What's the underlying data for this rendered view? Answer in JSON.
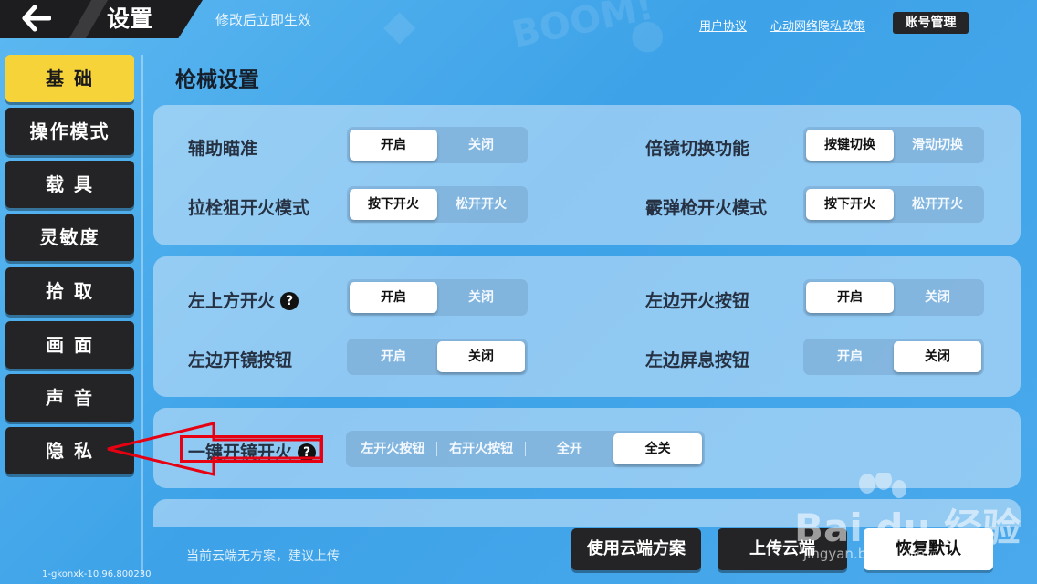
{
  "header": {
    "title": "设置",
    "hint": "修改后立即生效",
    "links": [
      "用户协议",
      "心动网络隐私政策"
    ],
    "account_label": "账号管理"
  },
  "sidebar": {
    "items": [
      {
        "label": "基 础",
        "active": true
      },
      {
        "label": "操作模式",
        "active": false
      },
      {
        "label": "载 具",
        "active": false
      },
      {
        "label": "灵敏度",
        "active": false
      },
      {
        "label": "拾 取",
        "active": false
      },
      {
        "label": "画 面",
        "active": false
      },
      {
        "label": "声 音",
        "active": false
      },
      {
        "label": "隐 私",
        "active": false
      }
    ],
    "version": "1-gkonxk-10.96.800230"
  },
  "main": {
    "section_title": "枪械设置",
    "panel1": {
      "aim_assist": {
        "label": "辅助瞄准",
        "options": [
          "开启",
          "关闭"
        ],
        "selected": 0
      },
      "bolt_fire": {
        "label": "拉栓狙开火模式",
        "options": [
          "按下开火",
          "松开开火"
        ],
        "selected": 0
      },
      "scope_switch": {
        "label": "倍镜切换功能",
        "options": [
          "按键切换",
          "滑动切换"
        ],
        "selected": 0
      },
      "shotgun_fire": {
        "label": "霰弹枪开火模式",
        "options": [
          "按下开火",
          "松开开火"
        ],
        "selected": 0
      }
    },
    "panel2": {
      "top_left_fire": {
        "label": "左上方开火",
        "options": [
          "开启",
          "关闭"
        ],
        "selected": 0
      },
      "left_scope": {
        "label": "左边开镜按钮",
        "options": [
          "开启",
          "关闭"
        ],
        "selected": 1
      },
      "left_fire_btn": {
        "label": "左边开火按钮",
        "options": [
          "开启",
          "关闭"
        ],
        "selected": 0
      },
      "left_hold_breath": {
        "label": "左边屏息按钮",
        "options": [
          "开启",
          "关闭"
        ],
        "selected": 1
      }
    },
    "panel3": {
      "one_key_scope": {
        "label": "一键开镜开火",
        "options": [
          "左开火按钮",
          "右开火按钮",
          "全开",
          "全关"
        ],
        "selected": 3
      }
    },
    "help_mark": "?"
  },
  "footer": {
    "cloud_hint": "当前云端无方案，建议上传",
    "use_cloud": "使用云端方案",
    "upload_cloud": "上传云端",
    "restore_default": "恢复默认"
  },
  "watermark": {
    "text": "Bai du 经验",
    "sub": "jingyan.baidu.com"
  },
  "colors": {
    "background": "#4aa9ec",
    "active_nav": "#f7d33a",
    "dark_button": "#242426",
    "annotation": "#e60012"
  }
}
